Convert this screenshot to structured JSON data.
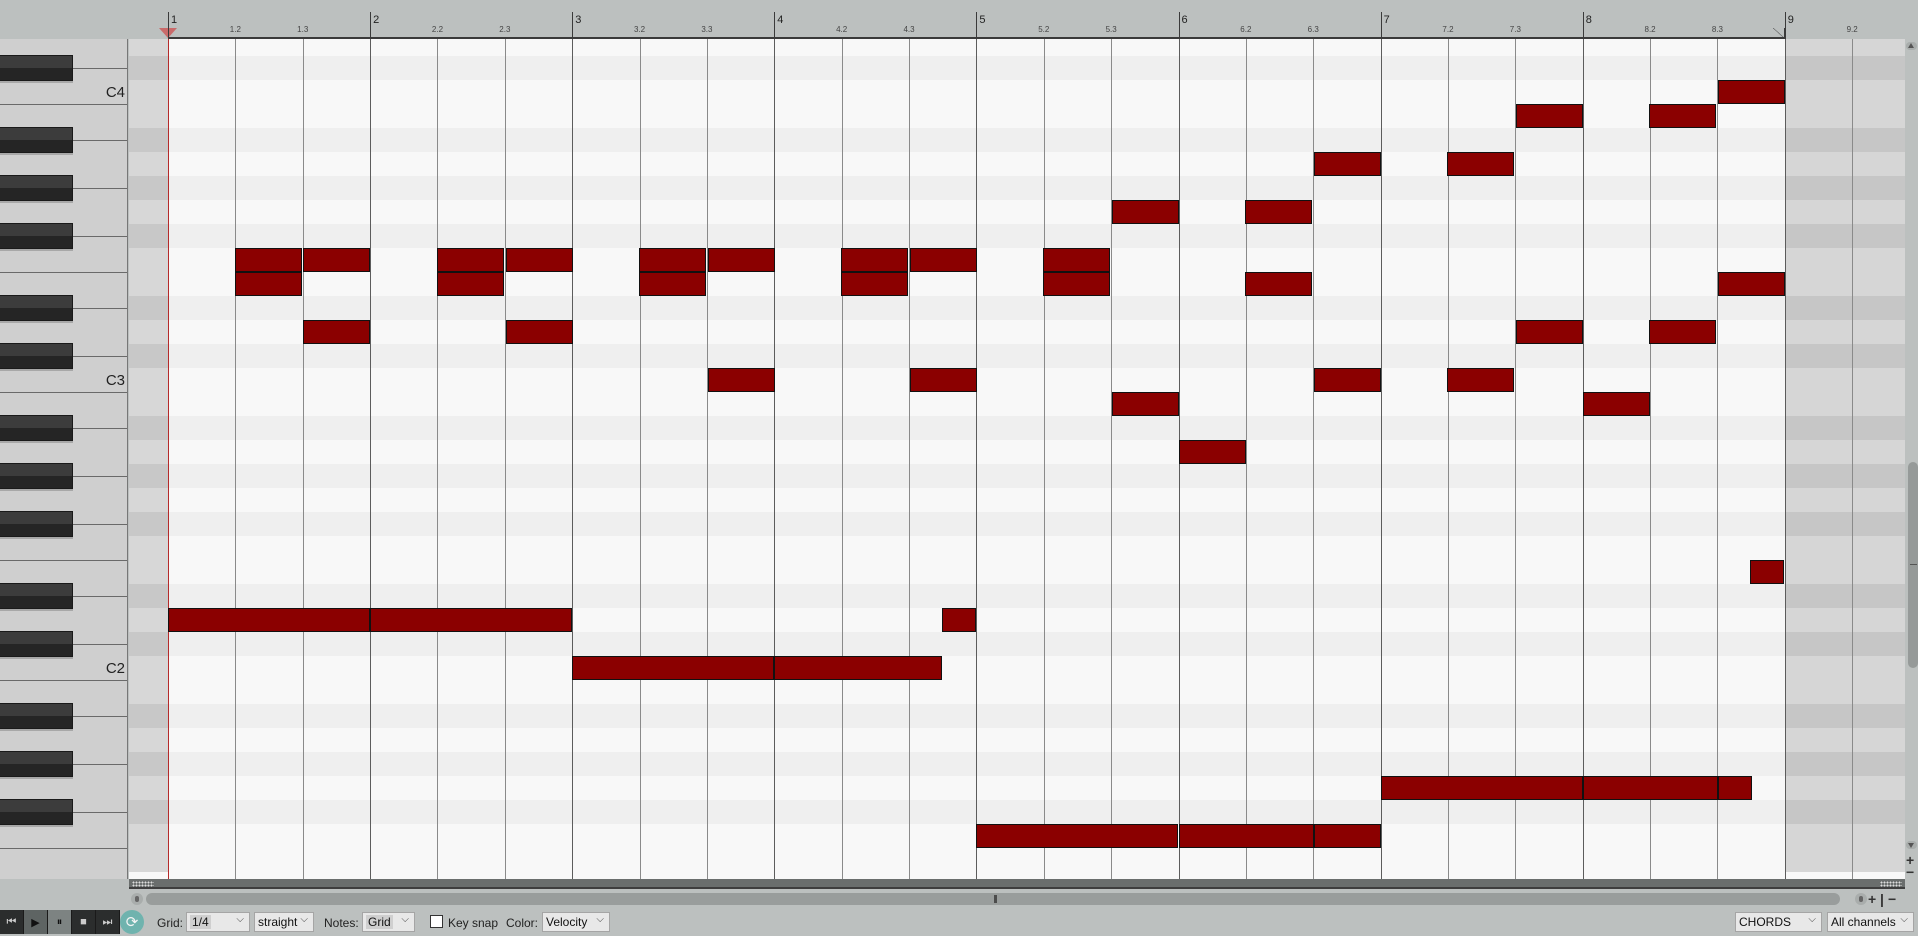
{
  "ruler": {
    "bars": [
      "1",
      "2",
      "3",
      "4",
      "5",
      "6",
      "7",
      "8",
      "9"
    ],
    "beat_labels": [
      [
        "1.2",
        "1.3"
      ],
      [
        "2.2",
        "2.3"
      ],
      [
        "3.2",
        "3.3"
      ],
      [
        "4.2",
        "4.3"
      ],
      [
        "5.2",
        "5.3"
      ],
      [
        "6.2",
        "6.3"
      ],
      [
        "7.2",
        "7.3"
      ],
      [
        "8.2",
        "8.3"
      ],
      [
        "9.2"
      ]
    ],
    "beats_per_bar": 3,
    "loop_start_bar": 1,
    "loop_end_bar": 9
  },
  "keyboard": {
    "top_pitch": "D4",
    "octave_labels": [
      {
        "label": "C4",
        "pitch": "C4"
      },
      {
        "label": "C3",
        "pitch": "C3"
      },
      {
        "label": "C2",
        "pitch": "C2"
      }
    ],
    "bottom_pitch": "E1"
  },
  "notes": [
    {
      "pitch": "C4",
      "start": 8.67,
      "length": 1
    },
    {
      "pitch": "B3",
      "start": 7.67,
      "length": 1
    },
    {
      "pitch": "B3",
      "start": 8.33,
      "length": 1
    },
    {
      "pitch": "A3",
      "start": 6.67,
      "length": 1
    },
    {
      "pitch": "A3",
      "start": 7.33,
      "length": 1
    },
    {
      "pitch": "G3",
      "start": 5.67,
      "length": 1
    },
    {
      "pitch": "G3",
      "start": 6.33,
      "length": 1
    },
    {
      "pitch": "F3",
      "start": 1.33,
      "length": 1
    },
    {
      "pitch": "F3",
      "start": 1.67,
      "length": 1
    },
    {
      "pitch": "F3",
      "start": 2.33,
      "length": 1
    },
    {
      "pitch": "F3",
      "start": 2.67,
      "length": 1
    },
    {
      "pitch": "F3",
      "start": 3.33,
      "length": 1
    },
    {
      "pitch": "F3",
      "start": 3.67,
      "length": 1
    },
    {
      "pitch": "F3",
      "start": 4.33,
      "length": 1
    },
    {
      "pitch": "F3",
      "start": 4.67,
      "length": 1
    },
    {
      "pitch": "F3",
      "start": 5.33,
      "length": 1
    },
    {
      "pitch": "E3",
      "start": 1.33,
      "length": 1
    },
    {
      "pitch": "E3",
      "start": 2.33,
      "length": 1
    },
    {
      "pitch": "E3",
      "start": 3.33,
      "length": 1
    },
    {
      "pitch": "E3",
      "start": 4.33,
      "length": 1
    },
    {
      "pitch": "E3",
      "start": 5.33,
      "length": 1
    },
    {
      "pitch": "E3",
      "start": 6.33,
      "length": 1
    },
    {
      "pitch": "E3",
      "start": 8.67,
      "length": 1
    },
    {
      "pitch": "D3",
      "start": 1.67,
      "length": 1
    },
    {
      "pitch": "D3",
      "start": 2.67,
      "length": 1
    },
    {
      "pitch": "D3",
      "start": 7.67,
      "length": 1
    },
    {
      "pitch": "D3",
      "start": 8.33,
      "length": 1
    },
    {
      "pitch": "C3",
      "start": 3.67,
      "length": 1
    },
    {
      "pitch": "C3",
      "start": 4.67,
      "length": 1
    },
    {
      "pitch": "C3",
      "start": 6.67,
      "length": 1
    },
    {
      "pitch": "C3",
      "start": 7.33,
      "length": 1
    },
    {
      "pitch": "B2",
      "start": 5.67,
      "length": 1
    },
    {
      "pitch": "B2",
      "start": 8.0,
      "length": 1
    },
    {
      "pitch": "A2",
      "start": 6.0,
      "length": 1
    },
    {
      "pitch": "E2",
      "start": 8.83,
      "length": 0.5
    },
    {
      "pitch": "D2",
      "start": 1.0,
      "length": 3
    },
    {
      "pitch": "D2",
      "start": 2.0,
      "length": 3
    },
    {
      "pitch": "D2",
      "start": 4.83,
      "length": 0.5
    },
    {
      "pitch": "C2",
      "start": 3.0,
      "length": 3
    },
    {
      "pitch": "C2",
      "start": 4.0,
      "length": 2.5
    },
    {
      "pitch": "G1",
      "start": 7.0,
      "length": 3
    },
    {
      "pitch": "G1",
      "start": 8.0,
      "length": 2
    },
    {
      "pitch": "G1",
      "start": 8.67,
      "length": 0.5
    },
    {
      "pitch": "F1",
      "start": 5.0,
      "length": 3
    },
    {
      "pitch": "F1",
      "start": 6.0,
      "length": 2
    },
    {
      "pitch": "F1",
      "start": 6.67,
      "length": 1
    }
  ],
  "note_color": "#8b0000",
  "playhead_color": "#b52a2a",
  "toolbar": {
    "transport": [
      {
        "name": "skip-to-start",
        "glyph": "⏮"
      },
      {
        "name": "play",
        "glyph": "▶"
      },
      {
        "name": "pause",
        "glyph": "⏸"
      },
      {
        "name": "stop",
        "glyph": "■"
      },
      {
        "name": "skip-to-end",
        "glyph": "⏭"
      }
    ],
    "loop_glyph": "⟳",
    "grid_label": "Grid:",
    "grid_value": "1/4",
    "grid_type_value": "straight",
    "notes_label": "Notes:",
    "notes_value": "Grid",
    "key_snap_label": "Key snap",
    "key_snap_checked": false,
    "color_label": "Color:",
    "color_value": "Velocity",
    "chords_value": "CHORDS",
    "channel_value": "All channels",
    "chevron": "⌵"
  },
  "hzoom": {
    "plus": "+",
    "minus": "−"
  },
  "vzoom": {
    "plus": "+",
    "minus": "−"
  }
}
